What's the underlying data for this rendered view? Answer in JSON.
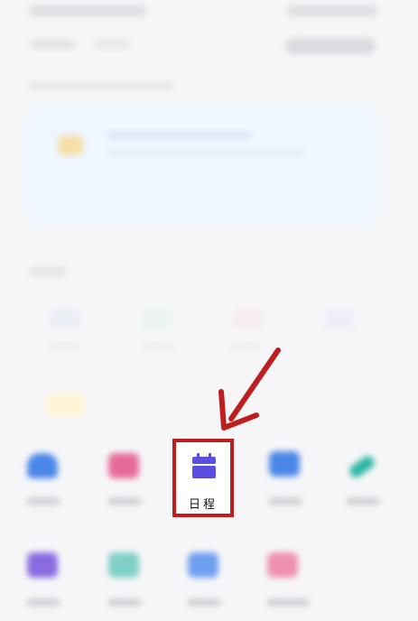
{
  "highlighted_app": {
    "label": "日程",
    "icon": "calendar-icon"
  },
  "colors": {
    "highlight_border": "#be1e1e",
    "arrow": "#be1e1e",
    "calendar_icon": "#5a4fe0",
    "banner_bg": "#eef6ff"
  }
}
